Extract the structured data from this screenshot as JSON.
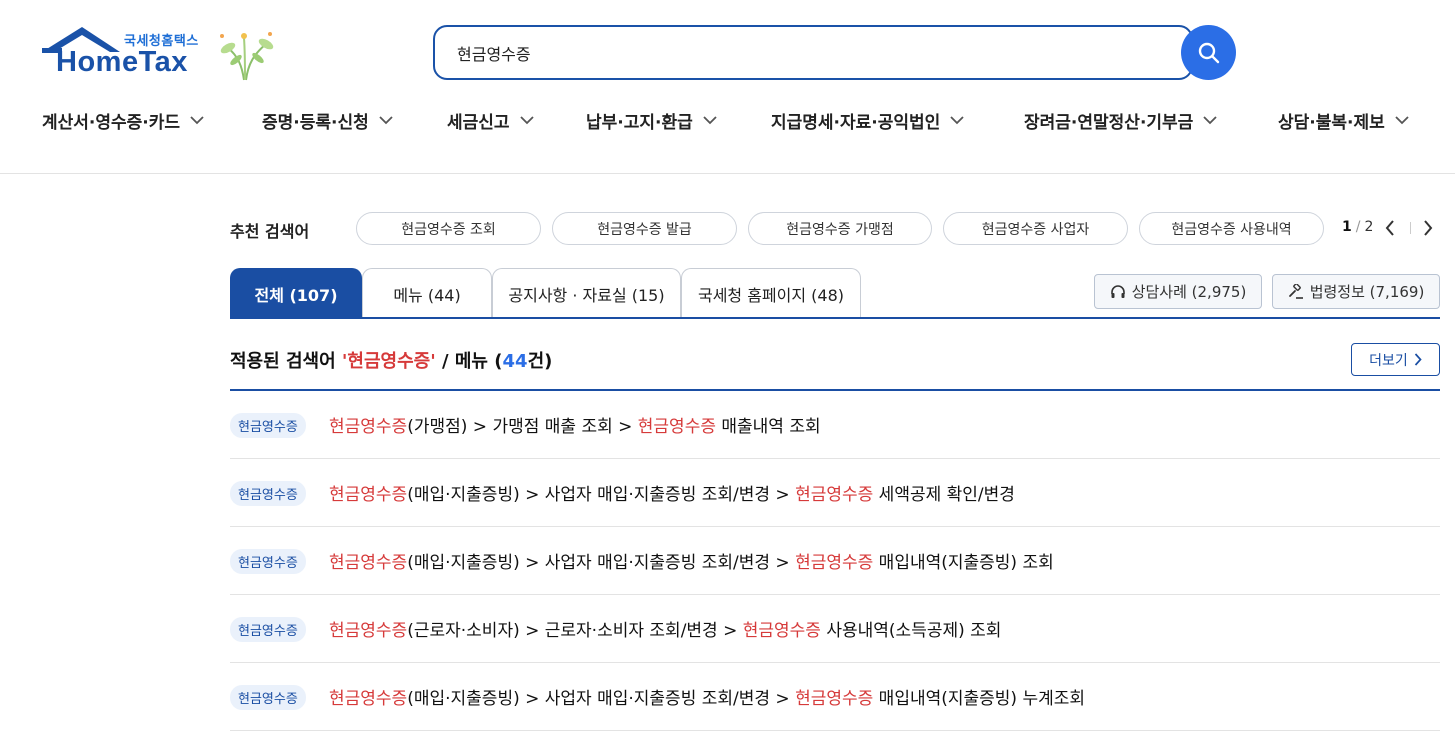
{
  "header": {
    "logo_kr": "국세청홈택스",
    "logo_en": "HomeTax",
    "search_value": "현금영수증"
  },
  "gnb": [
    "계산서·영수증·카드",
    "증명·등록·신청",
    "세금신고",
    "납부·고지·환급",
    "지급명세·자료·공익법인",
    "장려금·연말정산·기부금",
    "상담·불복·제보"
  ],
  "recommend": {
    "label": "추천 검색어",
    "chips": [
      "현금영수증 조회",
      "현금영수증 발급",
      "현금영수증 가맹점",
      "현금영수증 사업자",
      "현금영수증 사용내역"
    ],
    "page_current": "1",
    "page_total": "2"
  },
  "tabs": [
    "전체 (107)",
    "메뉴 (44)",
    "공지사항 · 자료실 (15)",
    "국세청 홈페이지 (48)"
  ],
  "side_buttons": {
    "consult": "상담사례 (2,975)",
    "law": "법령정보 (7,169)"
  },
  "results": {
    "title_prefix": "적용된 검색어",
    "keyword": "'현금영수증'",
    "title_mid": "/ 메뉴 (",
    "count": "44",
    "title_suffix": "건)",
    "more_label": "더보기",
    "rows": [
      {
        "badge": "현금영수증",
        "seg1": "현금영수증",
        "seg2": "(가맹점) > 가맹점 매출 조회 > ",
        "seg3": "현금영수증",
        "seg4": " 매출내역 조회"
      },
      {
        "badge": "현금영수증",
        "seg1": "현금영수증",
        "seg2": "(매입·지출증빙) > 사업자 매입·지출증빙 조회/변경 > ",
        "seg3": "현금영수증",
        "seg4": " 세액공제 확인/변경"
      },
      {
        "badge": "현금영수증",
        "seg1": "현금영수증",
        "seg2": "(매입·지출증빙) > 사업자 매입·지출증빙 조회/변경 > ",
        "seg3": "현금영수증",
        "seg4": " 매입내역(지출증빙) 조회"
      },
      {
        "badge": "현금영수증",
        "seg1": "현금영수증",
        "seg2": "(근로자·소비자) > 근로자·소비자 조회/변경 > ",
        "seg3": "현금영수증",
        "seg4": " 사용내역(소득공제) 조회"
      },
      {
        "badge": "현금영수증",
        "seg1": "현금영수증",
        "seg2": "(매입·지출증빙) > 사업자 매입·지출증빙 조회/변경 > ",
        "seg3": "현금영수증",
        "seg4": " 매입내역(지출증빙) 누계조회"
      }
    ]
  }
}
